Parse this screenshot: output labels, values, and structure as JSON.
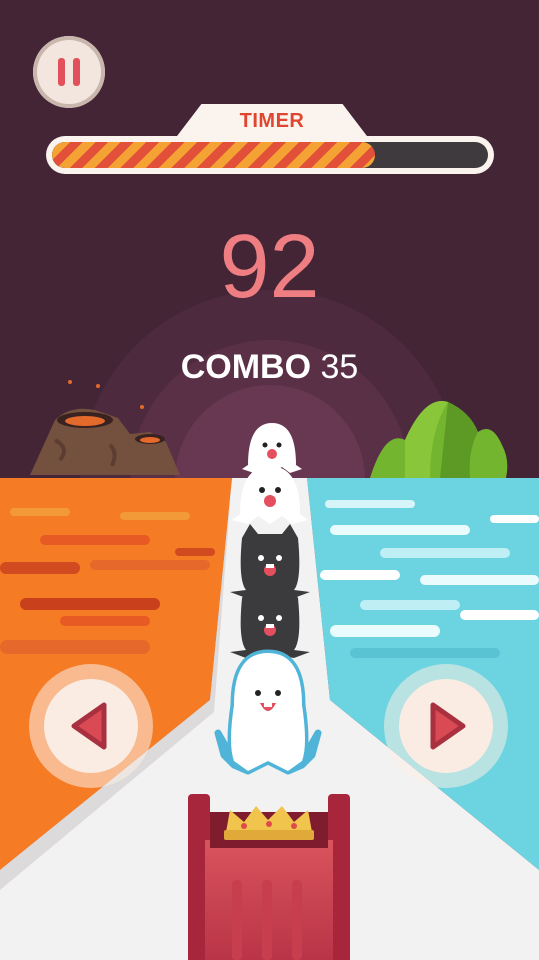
{
  "hud": {
    "timer_label": "TIMER",
    "timer_progress": 0.74,
    "score": "92",
    "combo_label": "COMBO",
    "combo_value": "35"
  },
  "controls": {
    "pause_icon": "pause-icon",
    "left_icon": "left-arrow-icon",
    "right_icon": "right-arrow-icon"
  },
  "colors": {
    "background": "#432536",
    "lava": "#f57b24",
    "water": "#6cd3e1",
    "score": "#ef7e82",
    "timer_stripe_a": "#f4a233",
    "timer_stripe_b": "#e2503a",
    "button_icon": "#d94a55"
  },
  "characters": [
    "ghost",
    "ghost",
    "black-cat",
    "black-cat",
    "ghost"
  ]
}
